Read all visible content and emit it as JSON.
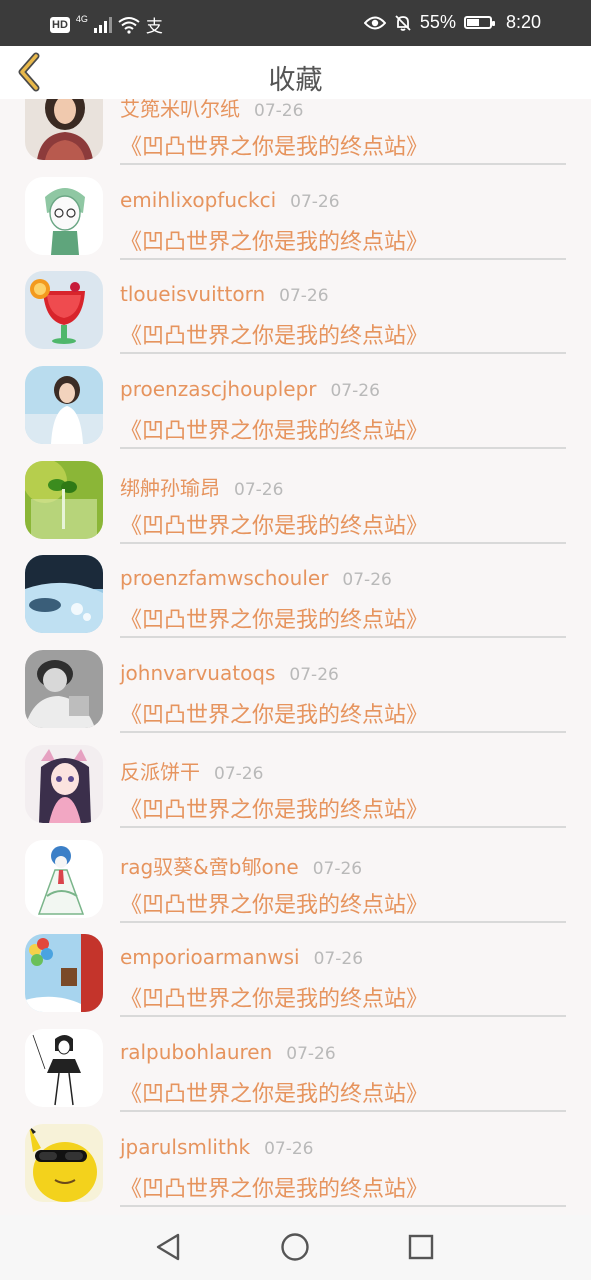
{
  "status_bar": {
    "hd": "HD",
    "network": "4G",
    "extra_icon": "支",
    "battery_percent": "55%",
    "battery_level": 0.55,
    "time": "8:20"
  },
  "header": {
    "title": "收藏",
    "back_icon": "chevron-left-icon",
    "accent_color": "#e8b84a"
  },
  "favorites": [
    {
      "name": "艾篼米叭尔纸",
      "date": "07-26",
      "work": "《凹凸世界之你是我的终点站》",
      "avatar": "girl-photo"
    },
    {
      "name": "emihlixopfuckci",
      "date": "07-26",
      "work": "《凹凸世界之你是我的终点站》",
      "avatar": "anime-boy-sketch"
    },
    {
      "name": "tloueisvuittorn",
      "date": "07-26",
      "work": "《凹凸世界之你是我的终点站》",
      "avatar": "red-cocktail"
    },
    {
      "name": "proenzascjhouplepr",
      "date": "07-26",
      "work": "《凹凸世界之你是我的终点站》",
      "avatar": "girl-beach"
    },
    {
      "name": "绑舯孙瑜昂",
      "date": "07-26",
      "work": "《凹凸世界之你是我的终点站》",
      "avatar": "green-sprout"
    },
    {
      "name": "proenzfamwschouler",
      "date": "07-26",
      "work": "《凹凸世界之你是我的终点站》",
      "avatar": "whale-sky"
    },
    {
      "name": "johnvarvuatoqs",
      "date": "07-26",
      "work": "《凹凸世界之你是我的终点站》",
      "avatar": "bw-portrait"
    },
    {
      "name": "反派饼干",
      "date": "07-26",
      "work": "《凹凸世界之你是我的终点站》",
      "avatar": "anime-girl"
    },
    {
      "name": "rag驭葵&啻b郇one",
      "date": "07-26",
      "work": "《凹凸世界之你是我的终点站》",
      "avatar": "gardevoir"
    },
    {
      "name": "emporioarmanwsi",
      "date": "07-26",
      "work": "《凹凸世界之你是我的终点站》",
      "avatar": "balloons"
    },
    {
      "name": "ralpubohlauren",
      "date": "07-26",
      "work": "《凹凸世界之你是我的终点站》",
      "avatar": "sketch-girl"
    },
    {
      "name": "jparulsmlithk",
      "date": "07-26",
      "work": "《凹凸世界之你是我的终点站》",
      "avatar": "pikachu-sunglasses"
    }
  ],
  "nav": {
    "back": "triangle-back-icon",
    "home": "circle-home-icon",
    "recents": "square-recents-icon"
  },
  "colors": {
    "accent": "#e6945e",
    "date": "#b9b9b9",
    "background": "#f9f6f6"
  }
}
